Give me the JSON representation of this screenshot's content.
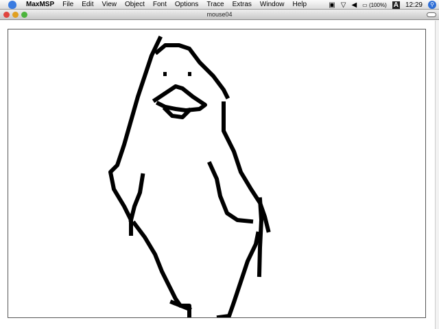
{
  "menubar": {
    "app": "MaxMSP",
    "items": [
      "File",
      "Edit",
      "View",
      "Object",
      "Font",
      "Options",
      "Trace",
      "Extras",
      "Window",
      "Help"
    ],
    "battery": "(100%)",
    "keyboard": "A",
    "clock": "12:29"
  },
  "window": {
    "title": "mouse04"
  },
  "colors": {
    "close": "#e0443e",
    "minimize": "#e0a020",
    "zoom": "#4cb43c",
    "ink": "#000000"
  }
}
